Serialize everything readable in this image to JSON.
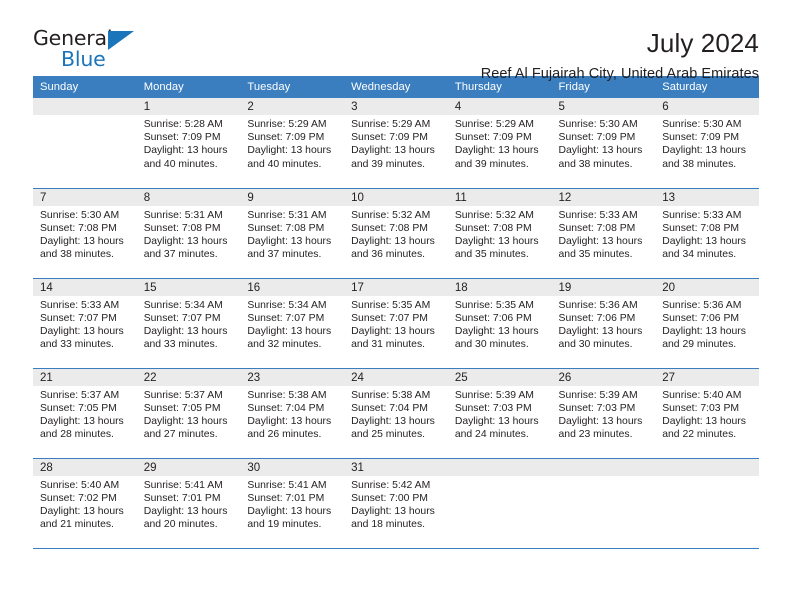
{
  "brand": {
    "name_part1": "General",
    "name_part2": "Blue",
    "triangle": "triangle-logo-mark"
  },
  "header": {
    "title": "July 2024",
    "subtitle": "Reef Al Fujairah City, United Arab Emirates"
  },
  "columns": [
    "Sunday",
    "Monday",
    "Tuesday",
    "Wednesday",
    "Thursday",
    "Friday",
    "Saturday"
  ],
  "colors": {
    "header_blue": "#3a7ebf",
    "daynum_grey": "#ebebeb",
    "brand_blue": "#1b75bb",
    "text": "#231f20"
  },
  "weeks": [
    [
      {
        "day": "",
        "empty": true
      },
      {
        "day": "1",
        "sunrise": "Sunrise: 5:28 AM",
        "sunset": "Sunset: 7:09 PM",
        "daylight_line1": "Daylight: 13 hours",
        "daylight_line2": "and 40 minutes."
      },
      {
        "day": "2",
        "sunrise": "Sunrise: 5:29 AM",
        "sunset": "Sunset: 7:09 PM",
        "daylight_line1": "Daylight: 13 hours",
        "daylight_line2": "and 40 minutes."
      },
      {
        "day": "3",
        "sunrise": "Sunrise: 5:29 AM",
        "sunset": "Sunset: 7:09 PM",
        "daylight_line1": "Daylight: 13 hours",
        "daylight_line2": "and 39 minutes."
      },
      {
        "day": "4",
        "sunrise": "Sunrise: 5:29 AM",
        "sunset": "Sunset: 7:09 PM",
        "daylight_line1": "Daylight: 13 hours",
        "daylight_line2": "and 39 minutes."
      },
      {
        "day": "5",
        "sunrise": "Sunrise: 5:30 AM",
        "sunset": "Sunset: 7:09 PM",
        "daylight_line1": "Daylight: 13 hours",
        "daylight_line2": "and 38 minutes."
      },
      {
        "day": "6",
        "sunrise": "Sunrise: 5:30 AM",
        "sunset": "Sunset: 7:09 PM",
        "daylight_line1": "Daylight: 13 hours",
        "daylight_line2": "and 38 minutes."
      }
    ],
    [
      {
        "day": "7",
        "sunrise": "Sunrise: 5:30 AM",
        "sunset": "Sunset: 7:08 PM",
        "daylight_line1": "Daylight: 13 hours",
        "daylight_line2": "and 38 minutes."
      },
      {
        "day": "8",
        "sunrise": "Sunrise: 5:31 AM",
        "sunset": "Sunset: 7:08 PM",
        "daylight_line1": "Daylight: 13 hours",
        "daylight_line2": "and 37 minutes."
      },
      {
        "day": "9",
        "sunrise": "Sunrise: 5:31 AM",
        "sunset": "Sunset: 7:08 PM",
        "daylight_line1": "Daylight: 13 hours",
        "daylight_line2": "and 37 minutes."
      },
      {
        "day": "10",
        "sunrise": "Sunrise: 5:32 AM",
        "sunset": "Sunset: 7:08 PM",
        "daylight_line1": "Daylight: 13 hours",
        "daylight_line2": "and 36 minutes."
      },
      {
        "day": "11",
        "sunrise": "Sunrise: 5:32 AM",
        "sunset": "Sunset: 7:08 PM",
        "daylight_line1": "Daylight: 13 hours",
        "daylight_line2": "and 35 minutes."
      },
      {
        "day": "12",
        "sunrise": "Sunrise: 5:33 AM",
        "sunset": "Sunset: 7:08 PM",
        "daylight_line1": "Daylight: 13 hours",
        "daylight_line2": "and 35 minutes."
      },
      {
        "day": "13",
        "sunrise": "Sunrise: 5:33 AM",
        "sunset": "Sunset: 7:08 PM",
        "daylight_line1": "Daylight: 13 hours",
        "daylight_line2": "and 34 minutes."
      }
    ],
    [
      {
        "day": "14",
        "sunrise": "Sunrise: 5:33 AM",
        "sunset": "Sunset: 7:07 PM",
        "daylight_line1": "Daylight: 13 hours",
        "daylight_line2": "and 33 minutes."
      },
      {
        "day": "15",
        "sunrise": "Sunrise: 5:34 AM",
        "sunset": "Sunset: 7:07 PM",
        "daylight_line1": "Daylight: 13 hours",
        "daylight_line2": "and 33 minutes."
      },
      {
        "day": "16",
        "sunrise": "Sunrise: 5:34 AM",
        "sunset": "Sunset: 7:07 PM",
        "daylight_line1": "Daylight: 13 hours",
        "daylight_line2": "and 32 minutes."
      },
      {
        "day": "17",
        "sunrise": "Sunrise: 5:35 AM",
        "sunset": "Sunset: 7:07 PM",
        "daylight_line1": "Daylight: 13 hours",
        "daylight_line2": "and 31 minutes."
      },
      {
        "day": "18",
        "sunrise": "Sunrise: 5:35 AM",
        "sunset": "Sunset: 7:06 PM",
        "daylight_line1": "Daylight: 13 hours",
        "daylight_line2": "and 30 minutes."
      },
      {
        "day": "19",
        "sunrise": "Sunrise: 5:36 AM",
        "sunset": "Sunset: 7:06 PM",
        "daylight_line1": "Daylight: 13 hours",
        "daylight_line2": "and 30 minutes."
      },
      {
        "day": "20",
        "sunrise": "Sunrise: 5:36 AM",
        "sunset": "Sunset: 7:06 PM",
        "daylight_line1": "Daylight: 13 hours",
        "daylight_line2": "and 29 minutes."
      }
    ],
    [
      {
        "day": "21",
        "sunrise": "Sunrise: 5:37 AM",
        "sunset": "Sunset: 7:05 PM",
        "daylight_line1": "Daylight: 13 hours",
        "daylight_line2": "and 28 minutes."
      },
      {
        "day": "22",
        "sunrise": "Sunrise: 5:37 AM",
        "sunset": "Sunset: 7:05 PM",
        "daylight_line1": "Daylight: 13 hours",
        "daylight_line2": "and 27 minutes."
      },
      {
        "day": "23",
        "sunrise": "Sunrise: 5:38 AM",
        "sunset": "Sunset: 7:04 PM",
        "daylight_line1": "Daylight: 13 hours",
        "daylight_line2": "and 26 minutes."
      },
      {
        "day": "24",
        "sunrise": "Sunrise: 5:38 AM",
        "sunset": "Sunset: 7:04 PM",
        "daylight_line1": "Daylight: 13 hours",
        "daylight_line2": "and 25 minutes."
      },
      {
        "day": "25",
        "sunrise": "Sunrise: 5:39 AM",
        "sunset": "Sunset: 7:03 PM",
        "daylight_line1": "Daylight: 13 hours",
        "daylight_line2": "and 24 minutes."
      },
      {
        "day": "26",
        "sunrise": "Sunrise: 5:39 AM",
        "sunset": "Sunset: 7:03 PM",
        "daylight_line1": "Daylight: 13 hours",
        "daylight_line2": "and 23 minutes."
      },
      {
        "day": "27",
        "sunrise": "Sunrise: 5:40 AM",
        "sunset": "Sunset: 7:03 PM",
        "daylight_line1": "Daylight: 13 hours",
        "daylight_line2": "and 22 minutes."
      }
    ],
    [
      {
        "day": "28",
        "sunrise": "Sunrise: 5:40 AM",
        "sunset": "Sunset: 7:02 PM",
        "daylight_line1": "Daylight: 13 hours",
        "daylight_line2": "and 21 minutes."
      },
      {
        "day": "29",
        "sunrise": "Sunrise: 5:41 AM",
        "sunset": "Sunset: 7:01 PM",
        "daylight_line1": "Daylight: 13 hours",
        "daylight_line2": "and 20 minutes."
      },
      {
        "day": "30",
        "sunrise": "Sunrise: 5:41 AM",
        "sunset": "Sunset: 7:01 PM",
        "daylight_line1": "Daylight: 13 hours",
        "daylight_line2": "and 19 minutes."
      },
      {
        "day": "31",
        "sunrise": "Sunrise: 5:42 AM",
        "sunset": "Sunset: 7:00 PM",
        "daylight_line1": "Daylight: 13 hours",
        "daylight_line2": "and 18 minutes."
      },
      {
        "day": "",
        "empty": true
      },
      {
        "day": "",
        "empty": true
      },
      {
        "day": "",
        "empty": true
      }
    ]
  ]
}
